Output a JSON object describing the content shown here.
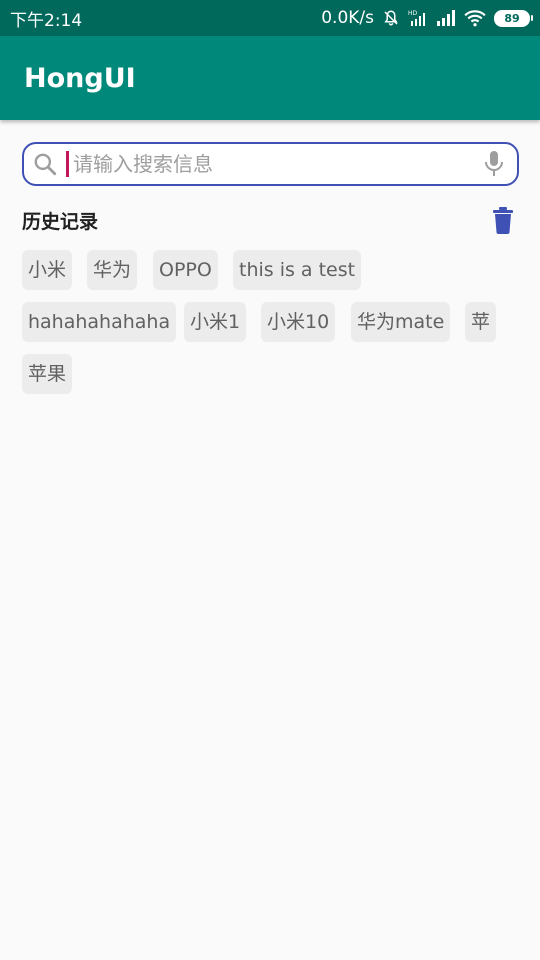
{
  "status_bar": {
    "time": "下午2:14",
    "network_speed": "0.0K/s",
    "battery": "89",
    "icons": [
      "bell-off-icon",
      "hd-signal-icon",
      "signal-icon",
      "wifi-icon",
      "battery-icon"
    ]
  },
  "app_bar": {
    "title": "HongUI"
  },
  "search": {
    "placeholder": "请输入搜索信息",
    "value": "",
    "icons": [
      "search-icon",
      "microphone-icon"
    ],
    "border_color": "#3f51b5",
    "cursor_color": "#c2185b"
  },
  "history": {
    "title": "历史记录",
    "clear_icon": "trash-icon",
    "tags": [
      "小米",
      "华为",
      "OPPO",
      "this is a test",
      "hahahahahaha",
      "小米1",
      "小米10",
      "华为mate",
      "苹",
      "苹果"
    ]
  },
  "colors": {
    "status_bar": "#00695c",
    "app_bar": "#00897b",
    "accent": "#3f51b5",
    "tag_bg": "#ececec",
    "background": "#fafafa"
  }
}
